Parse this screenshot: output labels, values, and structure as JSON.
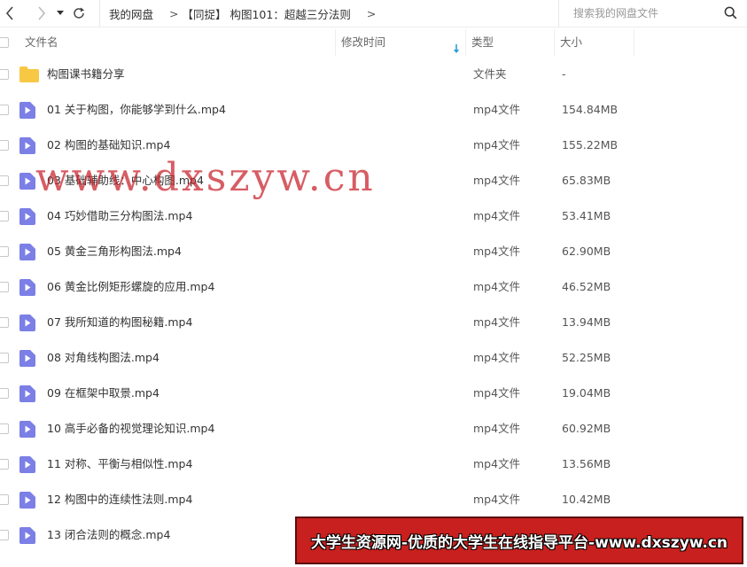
{
  "nav": {
    "back_icon": "chevron-left-icon",
    "forward_icon": "chevron-right-icon",
    "history_icon": "caret-down-icon",
    "refresh_icon": "refresh-icon"
  },
  "breadcrumb": {
    "root": "我的网盘",
    "folder": "【同捉】 构图101：超越三分法则",
    "separator": ">"
  },
  "search": {
    "placeholder": "搜索我的网盘文件",
    "icon": "search-icon"
  },
  "columns": {
    "name": "文件名",
    "modified": "修改时间",
    "type": "类型",
    "size": "大小",
    "sort_icon": "sort-down-arrow-icon"
  },
  "colors": {
    "folder": "#f7c843",
    "video": "#7b7fe6",
    "sort_arrow": "#2b9ed8",
    "watermark": "#c81e28",
    "banner_bg": "#c8201e"
  },
  "files": [
    {
      "name": "构图课书籍分享",
      "type": "文件夹",
      "size": "-",
      "icon": "folder-icon"
    },
    {
      "name": "01 关于构图，你能够学到什么.mp4",
      "type": "mp4文件",
      "size": "154.84MB",
      "icon": "video-file-icon"
    },
    {
      "name": "02 构图的基础知识.mp4",
      "type": "mp4文件",
      "size": "155.22MB",
      "icon": "video-file-icon"
    },
    {
      "name": "03 基础辅助线：中心构图.mp4",
      "type": "mp4文件",
      "size": "65.83MB",
      "icon": "video-file-icon"
    },
    {
      "name": "04 巧妙借助三分构图法.mp4",
      "type": "mp4文件",
      "size": "53.41MB",
      "icon": "video-file-icon"
    },
    {
      "name": "05 黄金三角形构图法.mp4",
      "type": "mp4文件",
      "size": "62.90MB",
      "icon": "video-file-icon"
    },
    {
      "name": "06 黄金比例矩形螺旋的应用.mp4",
      "type": "mp4文件",
      "size": "46.52MB",
      "icon": "video-file-icon"
    },
    {
      "name": "07 我所知道的构图秘籍.mp4",
      "type": "mp4文件",
      "size": "13.94MB",
      "icon": "video-file-icon"
    },
    {
      "name": "08 对角线构图法.mp4",
      "type": "mp4文件",
      "size": "52.25MB",
      "icon": "video-file-icon"
    },
    {
      "name": "09 在框架中取景.mp4",
      "type": "mp4文件",
      "size": "19.04MB",
      "icon": "video-file-icon"
    },
    {
      "name": "10 高手必备的视觉理论知识.mp4",
      "type": "mp4文件",
      "size": "60.92MB",
      "icon": "video-file-icon"
    },
    {
      "name": "11 对称、平衡与相似性.mp4",
      "type": "mp4文件",
      "size": "13.56MB",
      "icon": "video-file-icon"
    },
    {
      "name": "12 构图中的连续性法则.mp4",
      "type": "mp4文件",
      "size": "10.42MB",
      "icon": "video-file-icon"
    },
    {
      "name": "13 闭合法则的概念.mp4",
      "type": "",
      "size": "",
      "icon": "video-file-icon"
    }
  ],
  "watermark": "www.dxszyw.cn",
  "banner": "大学生资源网-优质的大学生在线指导平台-www.dxszyw.cn"
}
